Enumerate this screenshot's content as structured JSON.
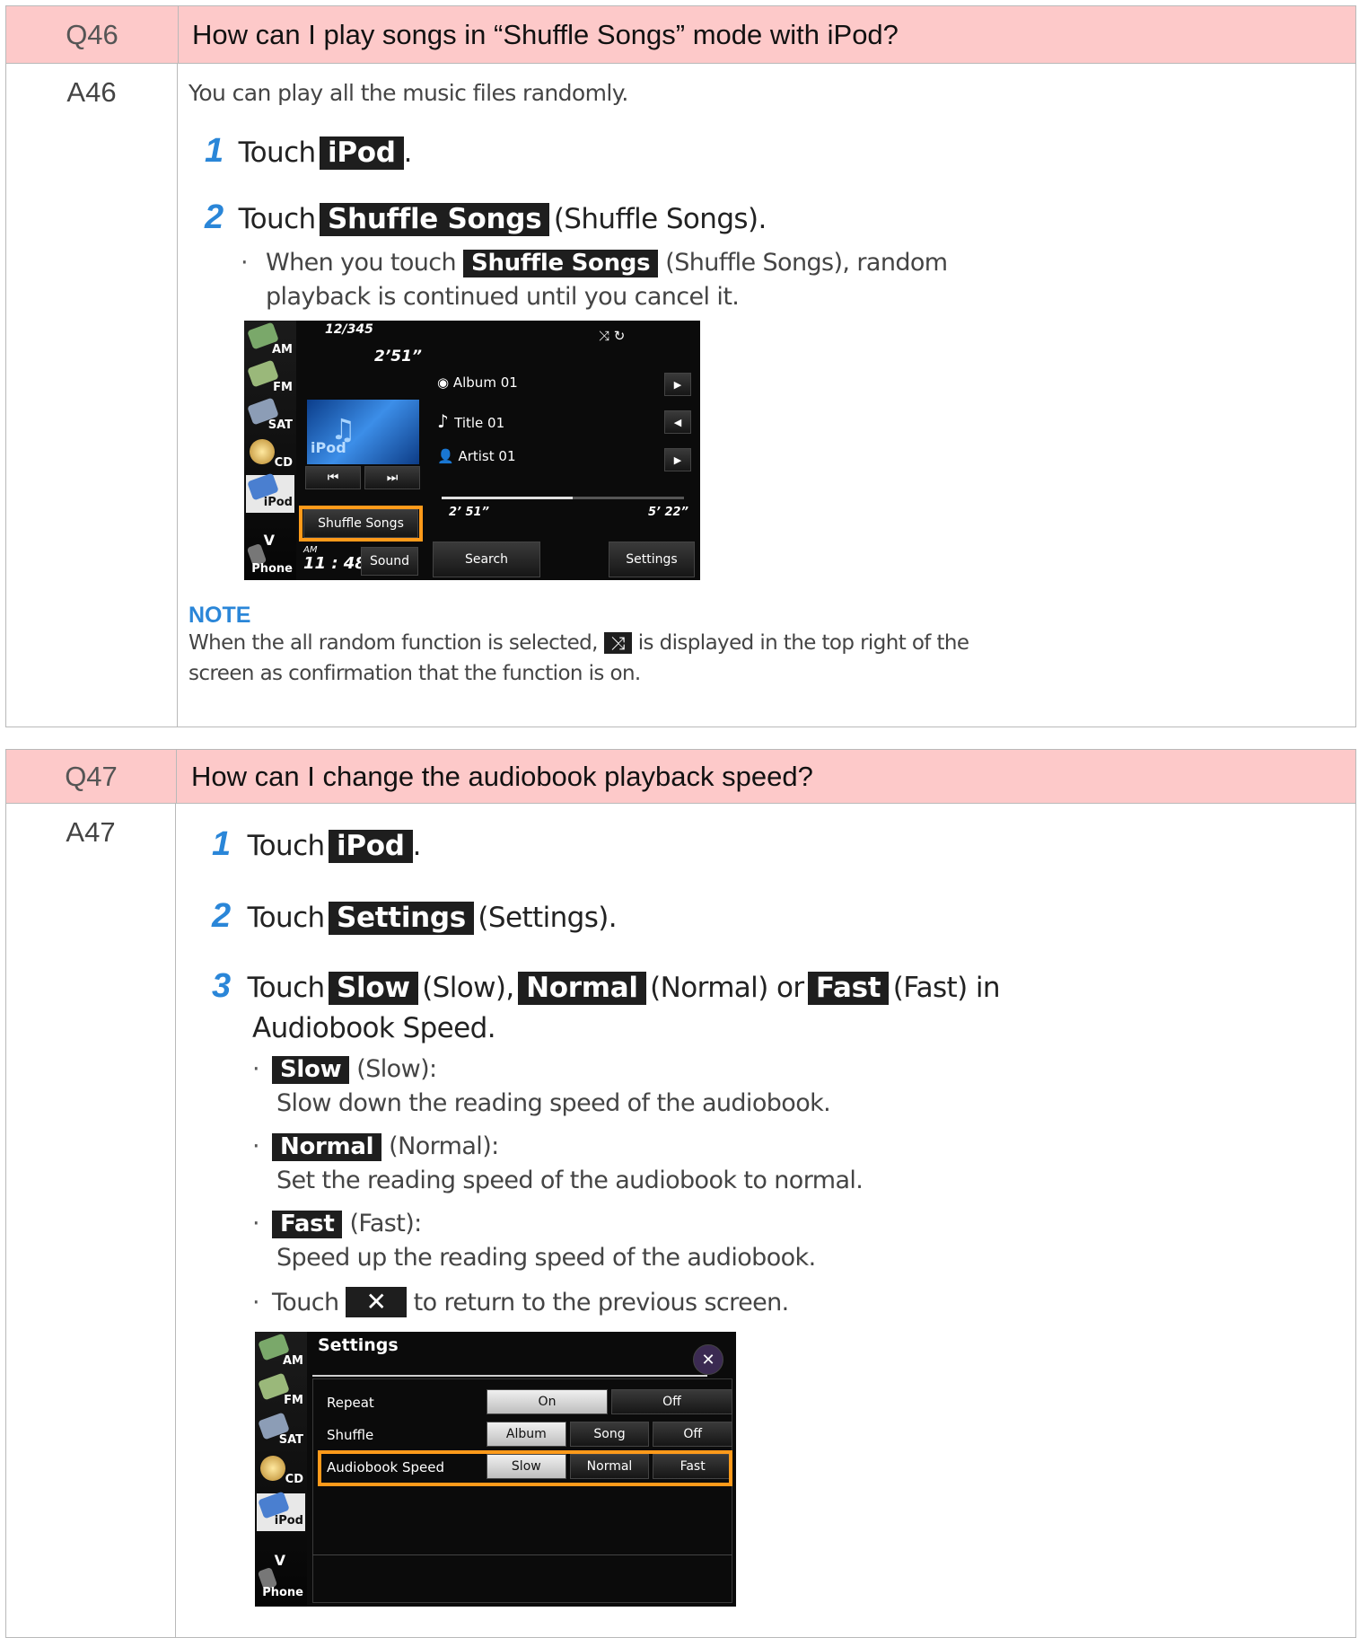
{
  "q46": {
    "num": "Q46",
    "question": "How can I play songs in “Shuffle Songs” mode with iPod?",
    "answer_num": "A46",
    "intro": "You can play all the music files randomly.",
    "step1": {
      "n": "1",
      "pre": "Touch",
      "tag": "iPod",
      "post": "."
    },
    "step2": {
      "n": "2",
      "pre": "Touch",
      "tag": "Shuffle Songs",
      "post": "(Shuffle Songs)."
    },
    "bullet": {
      "pre": "When you touch",
      "tag": "Shuffle Songs",
      "post": "(Shuffle Songs), random",
      "line2": "playback is continued until you cancel it."
    },
    "screen": {
      "sidebar": [
        "AM",
        "FM",
        "SAT",
        "CD",
        "iPod",
        "V",
        "Phone"
      ],
      "track_count": "12/345",
      "track_time": "2’51”",
      "album": "Album 01",
      "title": "Title 01",
      "artist": "Artist 01",
      "ipod_label": "iPod",
      "prev": "⏮",
      "next": "⏭",
      "shuffle_btn": "Shuffle Songs",
      "ampm": "AM",
      "clock": "11 : 48",
      "sound": "Sound",
      "elapsed": "2’ 51”",
      "total": "5’ 22”",
      "search": "Search",
      "settings": "Settings",
      "progress": 0.54
    },
    "note": {
      "heading": "NOTE",
      "line1_pre": "When the all random function is selected,",
      "line1_post": "is displayed in the top right of the",
      "line2": "screen as confirmation that the function is on."
    }
  },
  "q47": {
    "num": "Q47",
    "question": "How can I change the audiobook playback speed?",
    "answer_num": "A47",
    "step1": {
      "n": "1",
      "pre": "Touch",
      "tag": "iPod",
      "post": "."
    },
    "step2": {
      "n": "2",
      "pre": "Touch",
      "tag": "Settings",
      "post": "(Settings)."
    },
    "step3": {
      "n": "3",
      "pre": "Touch",
      "tag1": "Slow",
      "mid1": "(Slow),",
      "tag2": "Normal",
      "mid2": "(Normal) or",
      "tag3": "Fast",
      "post": "(Fast) in",
      "line2": "Audiobook Speed."
    },
    "bullets": [
      {
        "tag": "Slow",
        "label": "(Slow):",
        "desc": "Slow down the reading speed of the audiobook."
      },
      {
        "tag": "Normal",
        "label": "(Normal):",
        "desc": "Set the reading speed of the audiobook to normal."
      },
      {
        "tag": "Fast",
        "label": "(Fast):",
        "desc": "Speed up the reading speed of the audiobook."
      }
    ],
    "close_bullet": {
      "pre": "Touch",
      "icon": "✕",
      "post": "to return to the previous screen."
    },
    "screen": {
      "sidebar": [
        "AM",
        "FM",
        "SAT",
        "CD",
        "iPod",
        "V",
        "Phone"
      ],
      "title": "Settings",
      "close": "✕",
      "rows": [
        {
          "label": "Repeat",
          "options": [
            "On",
            "Off"
          ],
          "selected": "On"
        },
        {
          "label": "Shuffle",
          "options": [
            "Album",
            "Song",
            "Off"
          ],
          "selected": "Album"
        },
        {
          "label": "Audiobook Speed",
          "options": [
            "Slow",
            "Normal",
            "Fast"
          ],
          "selected": "Slow"
        }
      ]
    }
  },
  "colors": {
    "header_bg": "#fdc9c9",
    "step_blue": "#2a86d8",
    "highlight": "#ff9a1a"
  }
}
